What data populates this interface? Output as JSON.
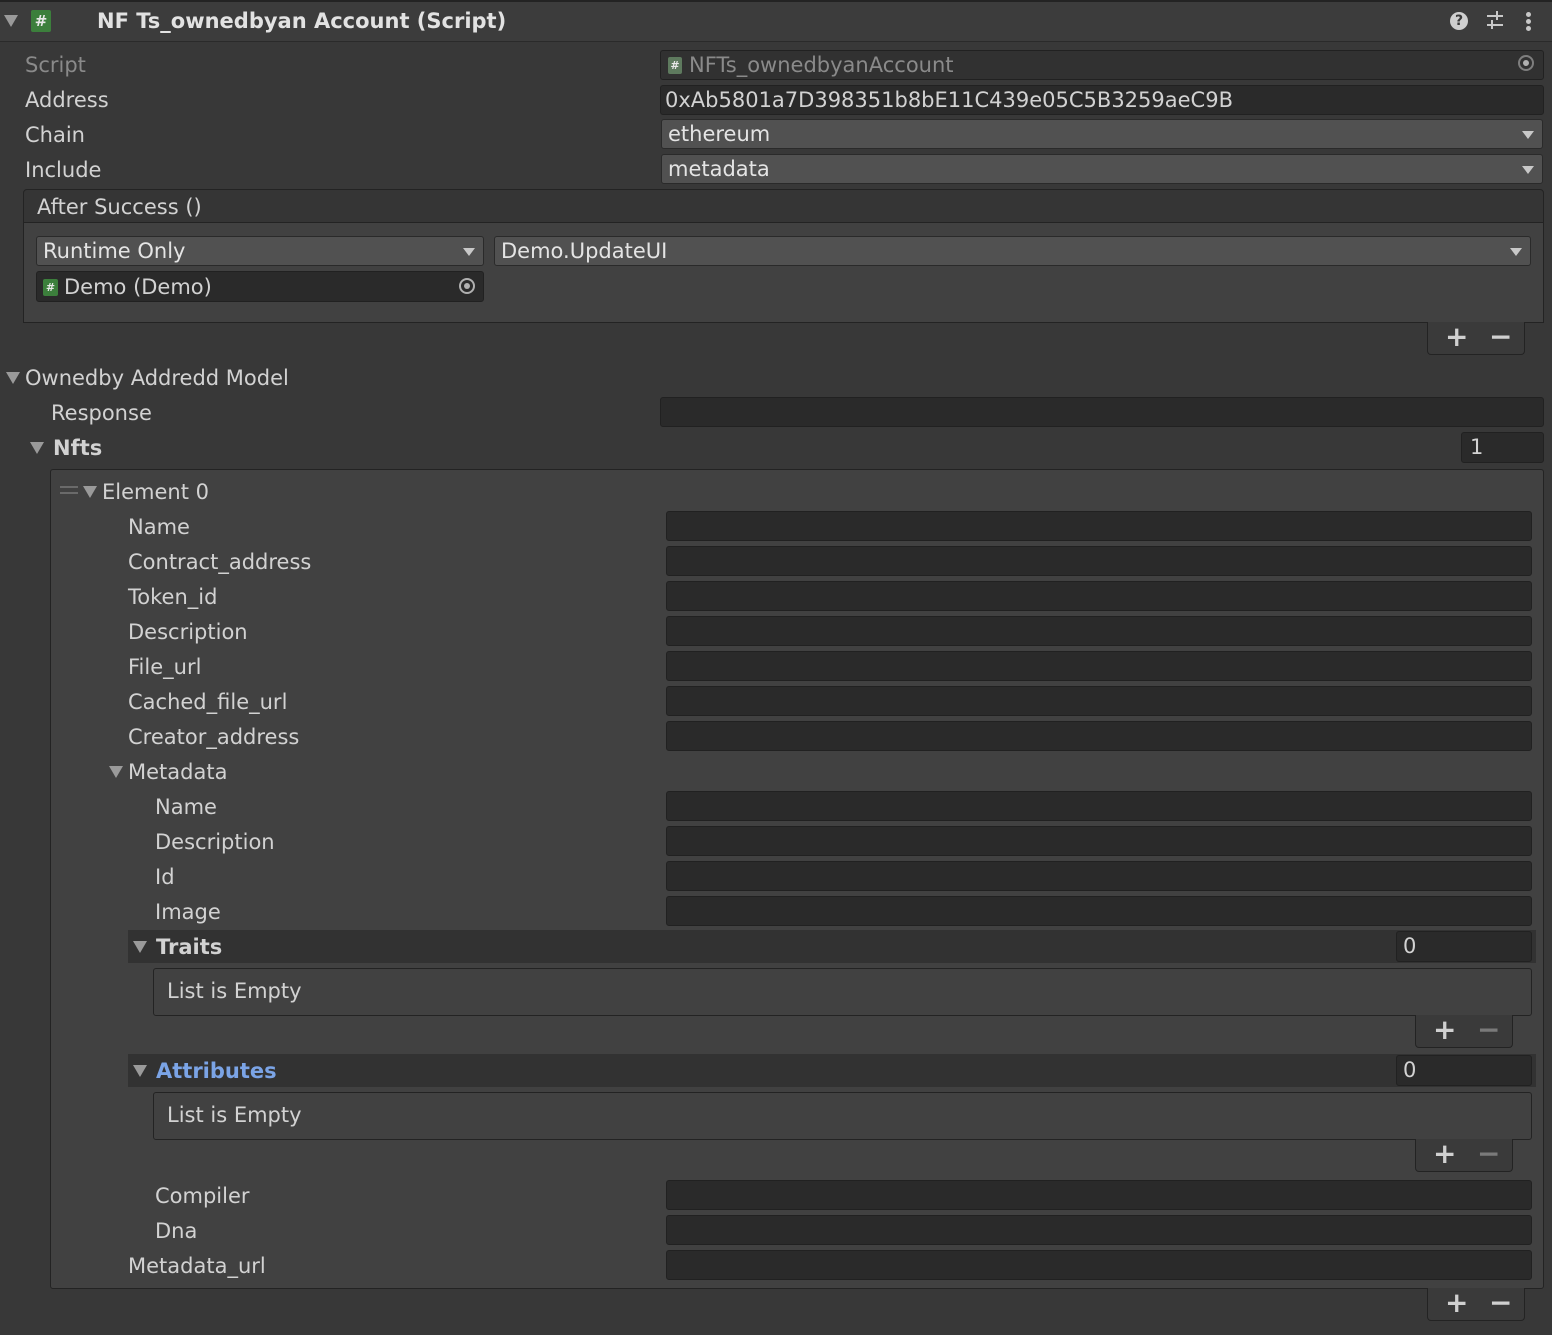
{
  "header": {
    "title": "NF Ts_ownedbyan Account (Script)",
    "script_icon": "#",
    "help_icon": "?",
    "settings_icon": "presets-icon",
    "menu_icon": "kebab-icon"
  },
  "script_row": {
    "label": "Script",
    "value": "NFTs_ownedbyanAccount"
  },
  "address": {
    "label": "Address",
    "value": "0xAb5801a7D398351b8bE11C439e05C5B3259aeC9B"
  },
  "chain": {
    "label": "Chain",
    "value": "ethereum"
  },
  "include": {
    "label": "Include",
    "value": "metadata"
  },
  "event": {
    "title": "After Success ()",
    "mode": "Runtime Only",
    "function": "Demo.UpdateUI",
    "target": "Demo (Demo)",
    "add": "+",
    "remove": "−"
  },
  "model": {
    "title": "Ownedby Addredd Model",
    "response_label": "Response",
    "response_value": "",
    "nfts_label": "Nfts",
    "nfts_count": "1",
    "element_title": "Element 0",
    "fields": {
      "name": "Name",
      "contract_address": "Contract_address",
      "token_id": "Token_id",
      "description": "Description",
      "file_url": "File_url",
      "cached_file_url": "Cached_file_url",
      "creator_address": "Creator_address"
    },
    "metadata": {
      "title": "Metadata",
      "name": "Name",
      "description": "Description",
      "id": "Id",
      "image": "Image",
      "traits_label": "Traits",
      "traits_count": "0",
      "traits_empty": "List is Empty",
      "attributes_label": "Attributes",
      "attributes_count": "0",
      "attributes_empty": "List is Empty",
      "compiler": "Compiler",
      "dna": "Dna"
    },
    "metadata_url": "Metadata_url",
    "add": "+",
    "remove": "−"
  },
  "colors": {
    "background": "#383838",
    "field": "#2a2a2a",
    "attributes_highlight": "#7ba4e6",
    "script_icon": "#3c7f3c"
  }
}
